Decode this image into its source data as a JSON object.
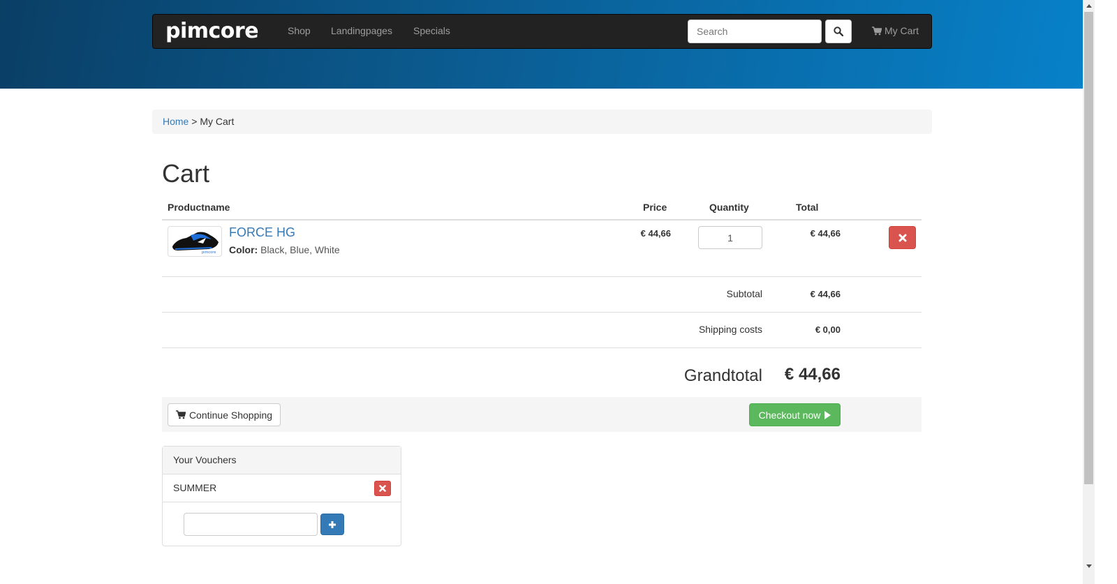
{
  "brand": {
    "logo_text": "pimcore"
  },
  "nav": {
    "items": [
      {
        "label": "Shop"
      },
      {
        "label": "Landingpages"
      },
      {
        "label": "Specials"
      }
    ]
  },
  "search": {
    "placeholder": "Search"
  },
  "header": {
    "cart_label": "My Cart"
  },
  "breadcrumb": {
    "home": "Home",
    "separator": ">",
    "current": "My Cart"
  },
  "page": {
    "title": "Cart"
  },
  "table": {
    "headers": {
      "product": "Productname",
      "price": "Price",
      "quantity": "Quantity",
      "total": "Total"
    },
    "items": [
      {
        "name": "FORCE HG",
        "color_label": "Color:",
        "color_value": "Black, Blue, White",
        "price": "€ 44,66",
        "quantity": "1",
        "total": "€ 44,66"
      }
    ]
  },
  "summary": {
    "subtotal_label": "Subtotal",
    "subtotal_value": "€ 44,66",
    "shipping_label": "Shipping costs",
    "shipping_value": "€ 0,00",
    "grandtotal_label": "Grandtotal",
    "grandtotal_value": "€ 44,66"
  },
  "actions": {
    "continue_label": "Continue Shopping",
    "checkout_label": "Checkout now"
  },
  "vouchers": {
    "title": "Your Vouchers",
    "items": [
      {
        "code": "SUMMER"
      }
    ],
    "input_value": ""
  },
  "colors": {
    "header_bg": "#222222",
    "hero_start": "#0a3f66",
    "hero_end": "#0781c9",
    "link": "#337ab7",
    "danger": "#d9534f",
    "success": "#5cb85c",
    "primary": "#337ab7"
  },
  "icons": {
    "search": "search-icon",
    "cart": "cart-icon",
    "remove": "times-icon",
    "checkout": "play-icon",
    "add": "plus-icon"
  }
}
